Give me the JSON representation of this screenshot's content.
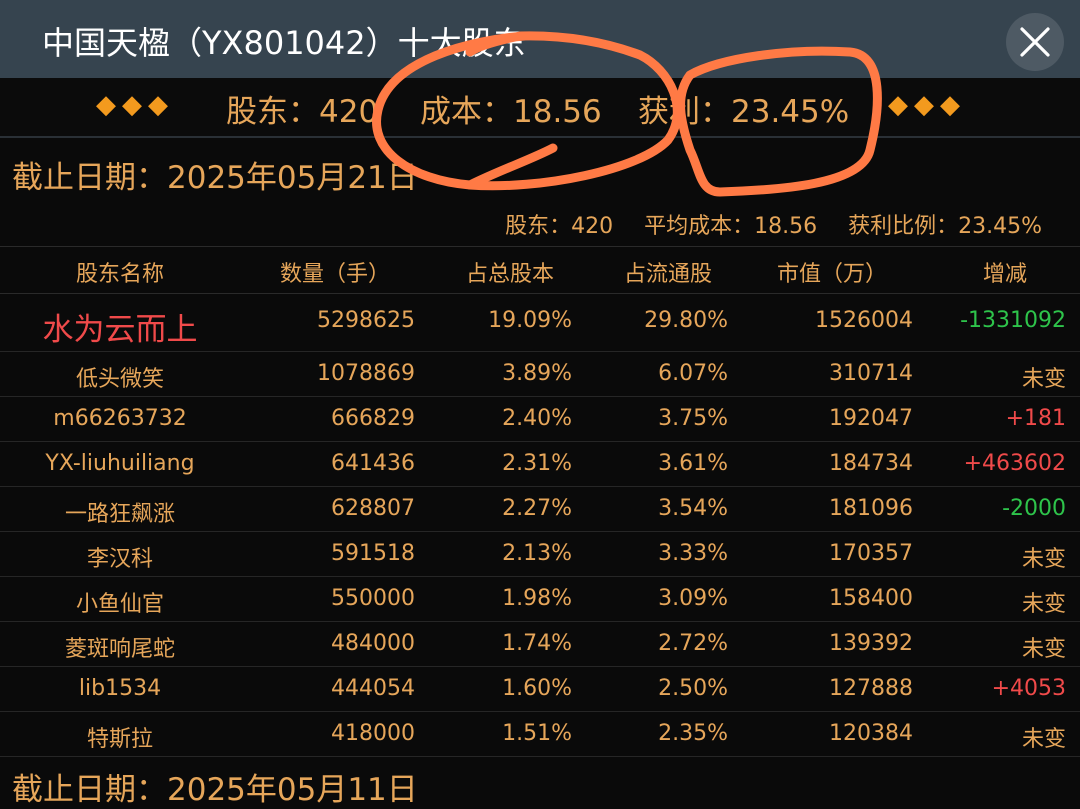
{
  "title": "中国天楹（YX801042）十大股东",
  "summary": {
    "diamonds_left": "◆◆◆",
    "holders": "股东：420",
    "cost": "成本：18.56",
    "profit": "获利：23.45%",
    "diamonds_right": "◆◆◆"
  },
  "date_label": "截止日期：2025年05月21日",
  "stats": {
    "holders": "股东：420",
    "avg_cost": "平均成本：18.56",
    "profit_ratio": "获利比例：23.45%"
  },
  "table": {
    "headers": [
      "股东名称",
      "数量（手）",
      "占总股本",
      "占流通股",
      "市值（万）",
      "增减"
    ],
    "rows": [
      [
        "水为云而上",
        "5298625",
        "19.09%",
        "29.80%",
        "1526004",
        "-1331092"
      ],
      [
        "低头微笑",
        "1078869",
        "3.89%",
        "6.07%",
        "310714",
        "未变"
      ],
      [
        "m66263732",
        "666829",
        "2.40%",
        "3.75%",
        "192047",
        "+181"
      ],
      [
        "YX-liuhuiliang",
        "641436",
        "2.31%",
        "3.61%",
        "184734",
        "+463602"
      ],
      [
        "一路狂飙涨",
        "628807",
        "2.27%",
        "3.54%",
        "181096",
        "-2000"
      ],
      [
        "李汉科",
        "591518",
        "2.13%",
        "3.33%",
        "170357",
        "未变"
      ],
      [
        "小鱼仙官",
        "550000",
        "1.98%",
        "3.09%",
        "158400",
        "未变"
      ],
      [
        "菱斑响尾蛇",
        "484000",
        "1.74%",
        "2.72%",
        "139392",
        "未变"
      ],
      [
        "lib1534",
        "444054",
        "1.60%",
        "2.50%",
        "127888",
        "+4053"
      ],
      [
        "特斯拉",
        "418000",
        "1.51%",
        "2.35%",
        "120384",
        "未变"
      ]
    ]
  },
  "bottom_date_label": "截止日期：2025年05月11日",
  "colors": {
    "title_bar": "#36444f",
    "text": "#e6a65a",
    "highlight_name": "#f04a4a",
    "decrease": "#2ec44b",
    "increase": "#f04a4a",
    "annotation": "#ff7a45"
  },
  "icons": {
    "close": "close-icon",
    "diamond": "diamond-icon"
  }
}
